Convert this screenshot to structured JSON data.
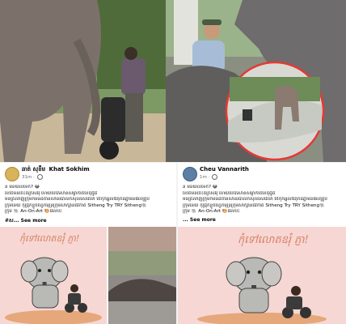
{
  "post_left": {
    "author_native": "ឆាត់ សុខឹម",
    "author": "Khat Sokhim",
    "time": "31m",
    "lines": [
      "និ មិនយល់ទេក៏? 😂",
      "ខែចៃមិនចេះគ័ក្រសអ៊ុំ ហើយបើតែសានសម្លាកាតខែតុជូជ",
      "មិនត្រលាញ់ក្រុមកីមិនិដ៏ចានសានរបាលកសុលរសវេលា ថែកុកអ្នលឪពុកដ៏គ្នាមិនផលត្រូប",
      "ក្រុមនេយ កុំជ្រុកខ្លួចហ្វេកមុន្រក្រុមសាក្សានជីវកាតិ Sitheng Try TRY Sitheng🐘",
      "ក្រុម 🐘 An-On-Art 🎨ផលប៉ះ"
    ],
    "see_more": "See more",
    "hashtags": "#ស... See more",
    "card_caption": "កុំទៅលោតឧរុំ ភ្ញា!"
  },
  "post_right": {
    "author": "Cheu Vannarith",
    "time": "1m",
    "lines": [
      "និ មិនយល់ទេក៏? 😂",
      "ខែចៃមិនចេះគ័ក្រសអ៊ុំ ហើយបើតែសានសម្លាកាតខែតុជូជ",
      "មិនត្រលាញ់ក្រុមកីមិនិដ៏ចានសានរបាលកសុលរសវេលា ថែកុកអ្នលឪពុកដ៏គ្នាមិនផលត្រូប",
      "ក្រុមនេយ កុំជ្រុកខ្លួចហ្វេកមុន្រក្រុមសាក្សានជីវកាតិ Sitheng Try TRY Sitheng🐘",
      "ក្រុម 🐘 An-On-Art 🎨ផលប៉ះ"
    ],
    "see_more": "... See more",
    "card_caption": "កុំទៅលោតឧរុំ ភ្ញា!"
  },
  "colors": {
    "caption": "#d97f61",
    "link": "#1b74e4",
    "card_bg": "#f6d7d3"
  }
}
